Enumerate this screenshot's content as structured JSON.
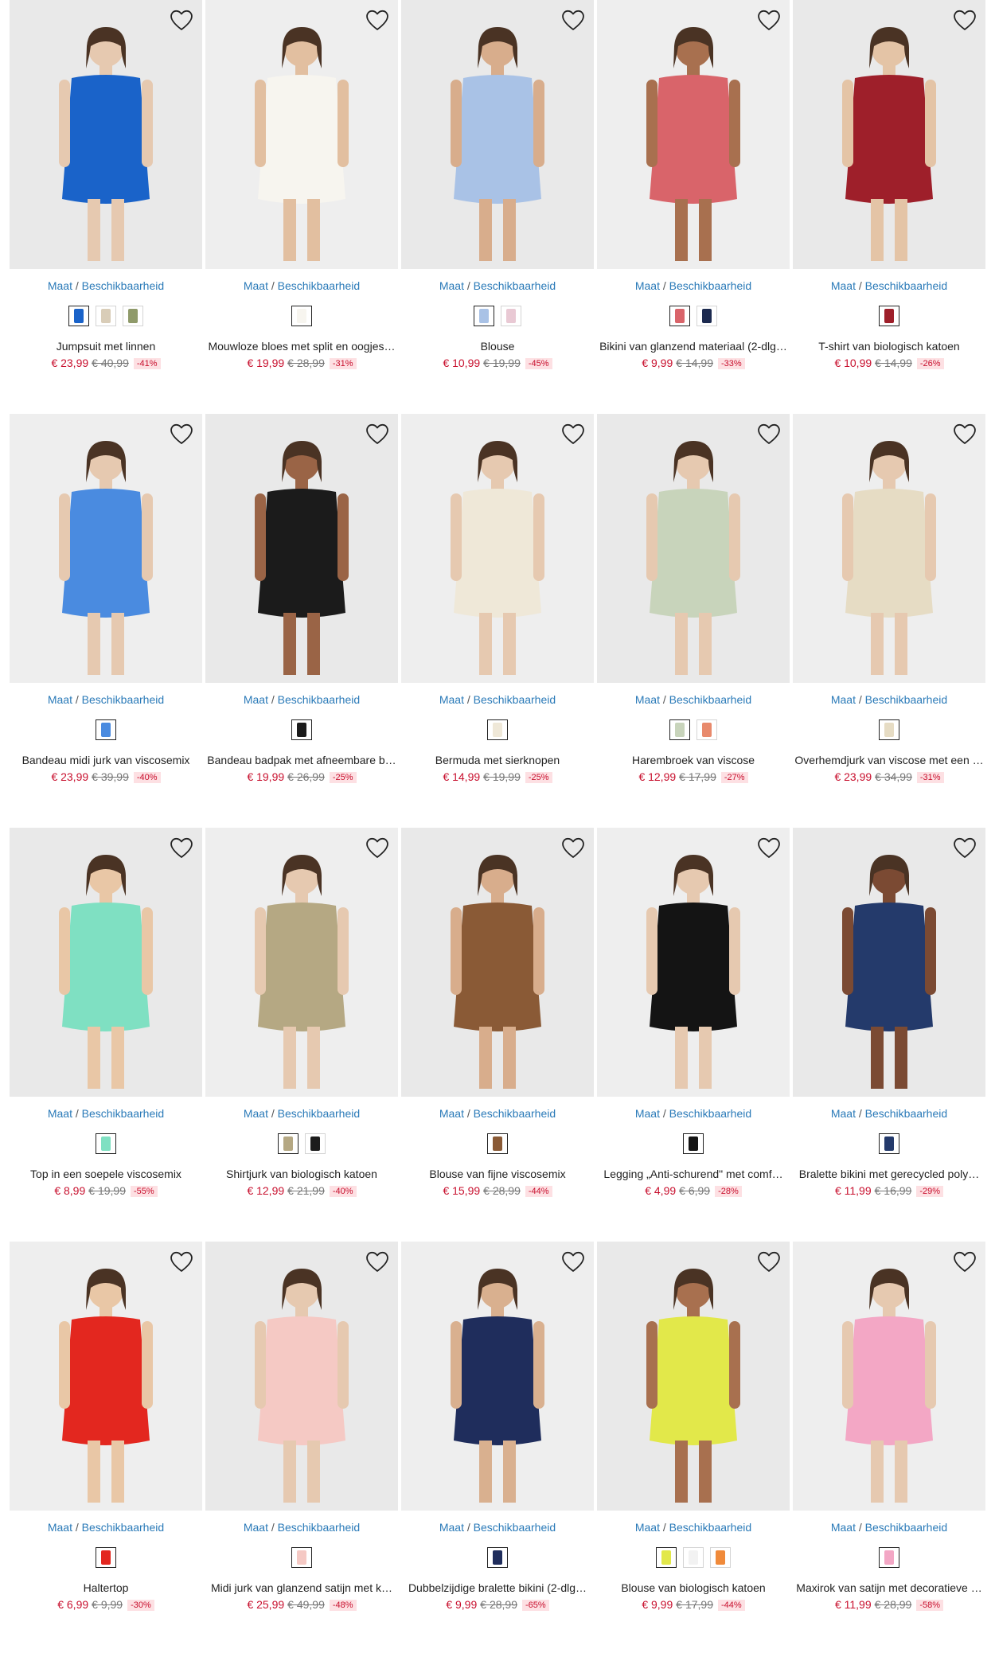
{
  "size_link": {
    "maat": "Maat",
    "sep": " / ",
    "beschikbaarheid": "Beschikbaarheid"
  },
  "icons": {
    "wishlist": "heart-outline-icon"
  },
  "products": [
    {
      "title": "Jumpsuit met linnen",
      "price": "€ 23,99",
      "old_price": "€ 40,99",
      "discount": "-41%",
      "image_color": "#1a63c9",
      "skin": "#e6c9b0",
      "swatches": [
        "#1a63c9",
        "#d9cdb8",
        "#8f9a6a"
      ]
    },
    {
      "title": "Mouwloze bloes met split en oogjes…",
      "price": "€ 19,99",
      "old_price": "€ 28,99",
      "discount": "-31%",
      "image_color": "#f7f5ef",
      "skin": "#e2bfa0",
      "swatches": [
        "#f7f5ef"
      ]
    },
    {
      "title": "Blouse",
      "price": "€ 10,99",
      "old_price": "€ 19,99",
      "discount": "-45%",
      "image_color": "#a9c2e6",
      "skin": "#d8ad8c",
      "swatches": [
        "#a9c2e6",
        "#e9c9d4"
      ]
    },
    {
      "title": "Bikini van glanzend materiaal (2-dlg…",
      "price": "€ 9,99",
      "old_price": "€ 14,99",
      "discount": "-33%",
      "image_color": "#d9646a",
      "skin": "#a8704f",
      "swatches": [
        "#d9646a",
        "#1c2a4f"
      ]
    },
    {
      "title": "T-shirt van biologisch katoen",
      "price": "€ 10,99",
      "old_price": "€ 14,99",
      "discount": "-26%",
      "image_color": "#9e1f2a",
      "skin": "#e4c4a6",
      "swatches": [
        "#9e1f2a"
      ]
    },
    {
      "title": "Bandeau midi jurk van viscosemix",
      "price": "€ 23,99",
      "old_price": "€ 39,99",
      "discount": "-40%",
      "image_color": "#4a8be0",
      "skin": "#e6c9b0",
      "swatches": [
        "#4a8be0"
      ]
    },
    {
      "title": "Bandeau badpak met afneembare b…",
      "price": "€ 19,99",
      "old_price": "€ 26,99",
      "discount": "-25%",
      "image_color": "#1b1b1b",
      "skin": "#9a6446",
      "swatches": [
        "#1b1b1b"
      ]
    },
    {
      "title": "Bermuda met sierknopen",
      "price": "€ 14,99",
      "old_price": "€ 19,99",
      "discount": "-25%",
      "image_color": "#efe8d8",
      "skin": "#e6c9b0",
      "swatches": [
        "#efe8d8"
      ]
    },
    {
      "title": "Harembroek van viscose",
      "price": "€ 12,99",
      "old_price": "€ 17,99",
      "discount": "-27%",
      "image_color": "#c8d4bb",
      "skin": "#e6c9b0",
      "swatches": [
        "#c8d4bb",
        "#e88a6c"
      ]
    },
    {
      "title": "Overhemdjurk van viscose met een …",
      "price": "€ 23,99",
      "old_price": "€ 34,99",
      "discount": "-31%",
      "image_color": "#e6dcc4",
      "skin": "#e6c9b0",
      "swatches": [
        "#e6dcc4"
      ]
    },
    {
      "title": "Top in een soepele viscosemix",
      "price": "€ 8,99",
      "old_price": "€ 19,99",
      "discount": "-55%",
      "image_color": "#7fe0c2",
      "skin": "#e9c7a6",
      "swatches": [
        "#7fe0c2"
      ]
    },
    {
      "title": "Shirtjurk van biologisch katoen",
      "price": "€ 12,99",
      "old_price": "€ 21,99",
      "discount": "-40%",
      "image_color": "#b5a883",
      "skin": "#e6c9b0",
      "swatches": [
        "#b5a883",
        "#1b1b1b"
      ]
    },
    {
      "title": "Blouse van fijne viscosemix",
      "price": "€ 15,99",
      "old_price": "€ 28,99",
      "discount": "-44%",
      "image_color": "#8a5a36",
      "skin": "#d8ad8c",
      "swatches": [
        "#8a5a36"
      ]
    },
    {
      "title": "Legging „Anti-schurend\" met comf…",
      "price": "€ 4,99",
      "old_price": "€ 6,99",
      "discount": "-28%",
      "image_color": "#141414",
      "skin": "#e6c9b0",
      "swatches": [
        "#141414"
      ]
    },
    {
      "title": "Bralette bikini met gerecycled poly…",
      "price": "€ 11,99",
      "old_price": "€ 16,99",
      "discount": "-29%",
      "image_color": "#243a6b",
      "skin": "#7b4a33",
      "swatches": [
        "#243a6b"
      ]
    },
    {
      "title": "Haltertop",
      "price": "€ 6,99",
      "old_price": "€ 9,99",
      "discount": "-30%",
      "image_color": "#e3271f",
      "skin": "#e9c7a6",
      "swatches": [
        "#e3271f"
      ]
    },
    {
      "title": "Midi jurk van glanzend satijn met k…",
      "price": "€ 25,99",
      "old_price": "€ 49,99",
      "discount": "-48%",
      "image_color": "#f5c9c4",
      "skin": "#e6c9b0",
      "swatches": [
        "#f5c9c4"
      ]
    },
    {
      "title": "Dubbelzijdige bralette bikini (2-dlg…",
      "price": "€ 9,99",
      "old_price": "€ 28,99",
      "discount": "-65%",
      "image_color": "#1f2d5c",
      "skin": "#d9b08f",
      "swatches": [
        "#1f2d5c"
      ]
    },
    {
      "title": "Blouse van biologisch katoen",
      "price": "€ 9,99",
      "old_price": "€ 17,99",
      "discount": "-44%",
      "image_color": "#e2e84a",
      "skin": "#a8704f",
      "swatches": [
        "#e2e84a",
        "#f2f2f2",
        "#f08a3a"
      ]
    },
    {
      "title": "Maxirok van satijn met decoratieve …",
      "price": "€ 11,99",
      "old_price": "€ 28,99",
      "discount": "-58%",
      "image_color": "#f3a7c5",
      "skin": "#e6c9b0",
      "swatches": [
        "#f3a7c5"
      ]
    }
  ]
}
